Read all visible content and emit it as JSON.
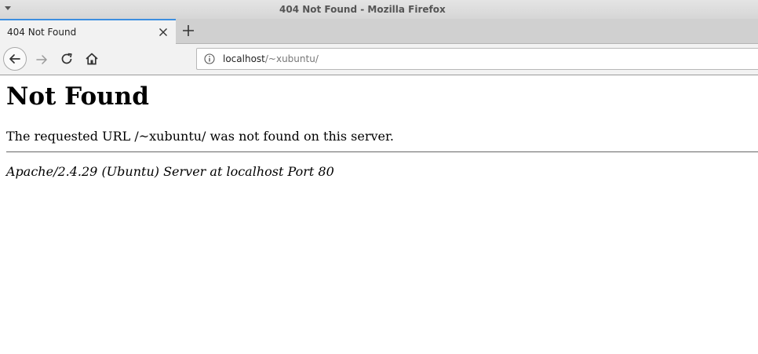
{
  "window": {
    "title": "404 Not Found - Mozilla Firefox"
  },
  "tabs": [
    {
      "label": "404 Not Found",
      "active": true
    }
  ],
  "navigation": {
    "url_host": "localhost",
    "url_path": "/~xubuntu/",
    "back_enabled": true,
    "forward_enabled": false
  },
  "page": {
    "heading": "Not Found",
    "message": "The requested URL /~xubuntu/ was not found on this server.",
    "server_signature": "Apache/2.4.29 (Ubuntu) Server at localhost Port 80"
  },
  "colors": {
    "active_tab_accent": "#3d8fe0"
  }
}
